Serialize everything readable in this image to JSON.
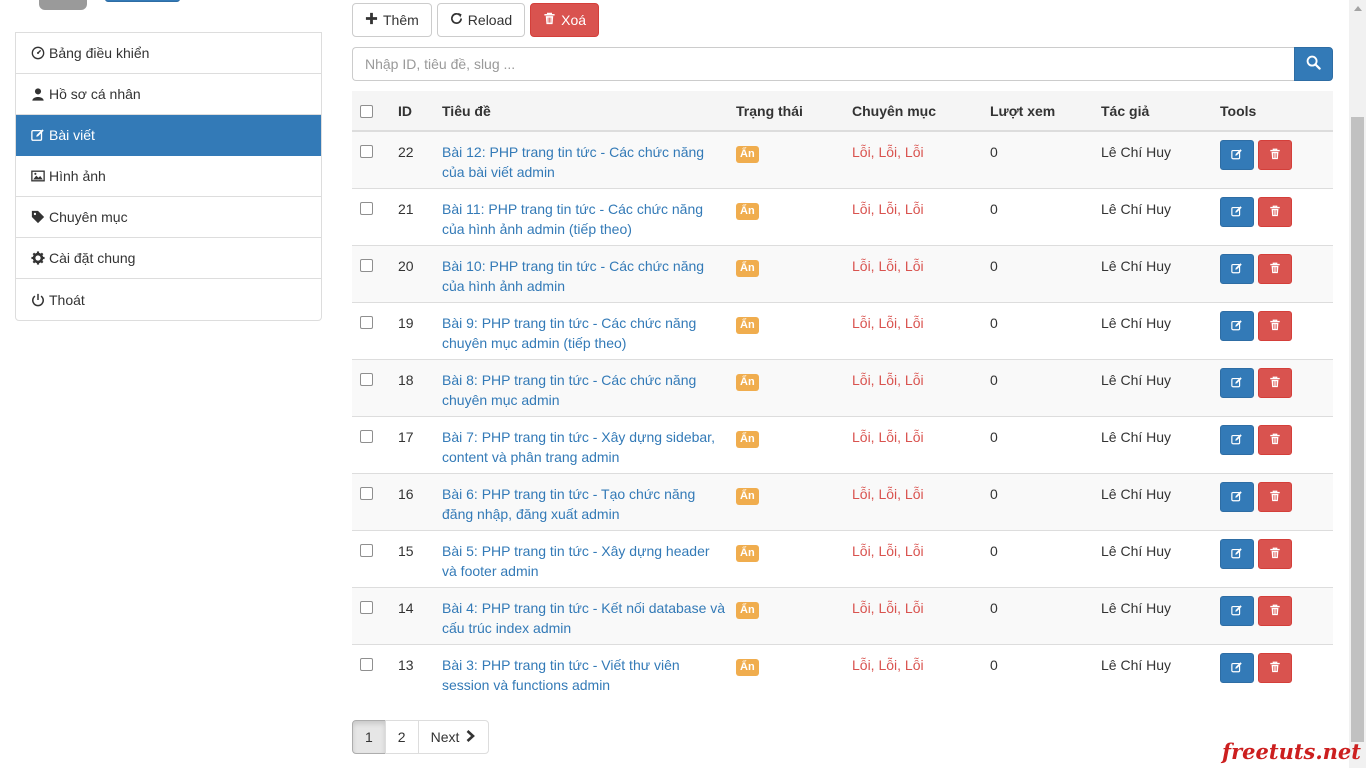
{
  "sidebar": {
    "items": [
      {
        "label": "Bảng điều khiển",
        "icon": "dashboard-icon",
        "active": false
      },
      {
        "label": "Hồ sơ cá nhân",
        "icon": "user-icon",
        "active": false
      },
      {
        "label": "Bài viết",
        "icon": "edit-icon",
        "active": true
      },
      {
        "label": "Hình ảnh",
        "icon": "image-icon",
        "active": false
      },
      {
        "label": "Chuyên mục",
        "icon": "tag-icon",
        "active": false
      },
      {
        "label": "Cài đặt chung",
        "icon": "gear-icon",
        "active": false
      },
      {
        "label": "Thoát",
        "icon": "power-icon",
        "active": false
      }
    ]
  },
  "toolbar": {
    "add_label": "Thêm",
    "reload_label": "Reload",
    "delete_label": "Xoá"
  },
  "search": {
    "placeholder": "Nhập ID, tiêu đề, slug ...",
    "value": ""
  },
  "table": {
    "columns": [
      "ID",
      "Tiêu đề",
      "Trạng thái",
      "Chuyên mục",
      "Lượt xem",
      "Tác giả",
      "Tools"
    ],
    "rows": [
      {
        "id": "22",
        "title": "Bài 12: PHP trang tin tức - Các chức năng của bài viết admin",
        "status": "Ẩn",
        "category": "Lỗi, Lỗi, Lỗi",
        "views": "0",
        "author": "Lê Chí Huy"
      },
      {
        "id": "21",
        "title": "Bài 11: PHP trang tin tức - Các chức năng của hình ảnh admin (tiếp theo)",
        "status": "Ẩn",
        "category": "Lỗi, Lỗi, Lỗi",
        "views": "0",
        "author": "Lê Chí Huy"
      },
      {
        "id": "20",
        "title": "Bài 10: PHP trang tin tức - Các chức năng của hình ảnh admin",
        "status": "Ẩn",
        "category": "Lỗi, Lỗi, Lỗi",
        "views": "0",
        "author": "Lê Chí Huy"
      },
      {
        "id": "19",
        "title": "Bài 9: PHP trang tin tức - Các chức năng chuyên mục admin (tiếp theo)",
        "status": "Ẩn",
        "category": "Lỗi, Lỗi, Lỗi",
        "views": "0",
        "author": "Lê Chí Huy"
      },
      {
        "id": "18",
        "title": "Bài 8: PHP trang tin tức - Các chức năng chuyên mục admin",
        "status": "Ẩn",
        "category": "Lỗi, Lỗi, Lỗi",
        "views": "0",
        "author": "Lê Chí Huy"
      },
      {
        "id": "17",
        "title": "Bài 7: PHP trang tin tức - Xây dựng sidebar, content và phân trang admin",
        "status": "Ẩn",
        "category": "Lỗi, Lỗi, Lỗi",
        "views": "0",
        "author": "Lê Chí Huy"
      },
      {
        "id": "16",
        "title": "Bài 6: PHP trang tin tức - Tạo chức năng đăng nhập, đăng xuất admin",
        "status": "Ẩn",
        "category": "Lỗi, Lỗi, Lỗi",
        "views": "0",
        "author": "Lê Chí Huy"
      },
      {
        "id": "15",
        "title": "Bài 5: PHP trang tin tức - Xây dựng header và footer admin",
        "status": "Ẩn",
        "category": "Lỗi, Lỗi, Lỗi",
        "views": "0",
        "author": "Lê Chí Huy"
      },
      {
        "id": "14",
        "title": "Bài 4: PHP trang tin tức - Kết nối database và cấu trúc index admin",
        "status": "Ẩn",
        "category": "Lỗi, Lỗi, Lỗi",
        "views": "0",
        "author": "Lê Chí Huy"
      },
      {
        "id": "13",
        "title": "Bài 3: PHP trang tin tức - Viết thư viên session và functions admin",
        "status": "Ẩn",
        "category": "Lỗi, Lỗi, Lỗi",
        "views": "0",
        "author": "Lê Chí Huy"
      }
    ]
  },
  "pagination": {
    "pages": [
      "1",
      "2"
    ],
    "current": "1",
    "next_label": "Next"
  },
  "watermark": "freetuts.net",
  "colors": {
    "primary": "#337ab7",
    "danger": "#d9534f",
    "warning": "#f0ad4e"
  }
}
